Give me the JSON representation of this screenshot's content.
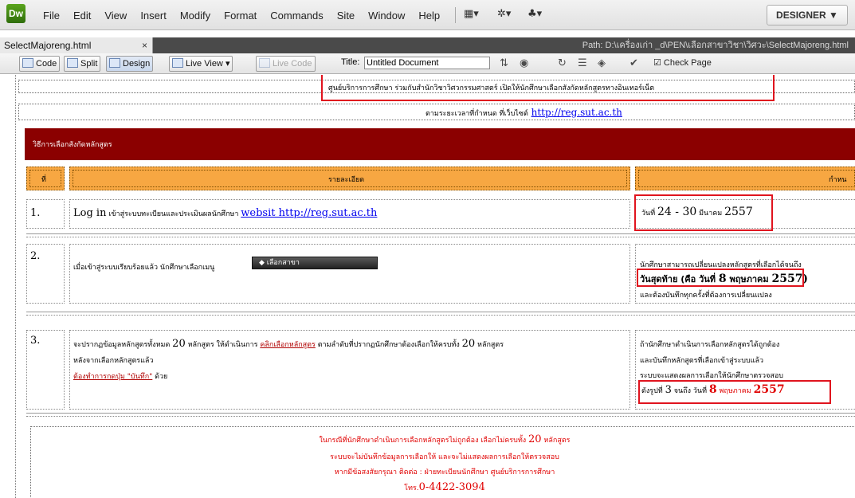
{
  "app": {
    "logo": "Dw",
    "menu": [
      "File",
      "Edit",
      "View",
      "Insert",
      "Modify",
      "Format",
      "Commands",
      "Site",
      "Window",
      "Help"
    ],
    "workspace": "DESIGNER ▼"
  },
  "document": {
    "tab_name": "SelectMajoreng.html",
    "close": "×",
    "path": "Path:  D:\\เครื่องเก่า _d\\PEN\\เลือกสาขาวิชา\\วิศวะ\\SelectMajoreng.html"
  },
  "toolbar": {
    "code": "Code",
    "split": "Split",
    "design": "Design",
    "live_view": "Live View",
    "live_code": "Live Code",
    "title_label": "Title:",
    "title_value": "Untitled Document",
    "check_page": "Check Page"
  },
  "page": {
    "intro_line": "ศูนย์บริการการศึกษา ร่วมกับสำนักวิชาวิศวกรรมศาสตร์ เปิดให้นักศึกษาเลือกสังกัดหลักสูตรทางอินเทอร์เน็ต",
    "schedule_prefix": "ตามระยะเวลาที่กำหนด ที่เว็บไซต์",
    "schedule_link": "http://reg.sut.ac.th",
    "banner": "วิธีการเลือกสังกัดหลักสูตร",
    "headers": {
      "no": "ที่",
      "detail": "รายละเอียด",
      "deadline": "กำหน"
    },
    "row1": {
      "no": "1.",
      "text_login": "Log in",
      "text": " เข้าสู่ระบบทะเบียนและประเมินผลนักศึกษา ",
      "link": "websit http://reg.sut.ac.th",
      "date_prefix": "วันที่ ",
      "date_num": "24 - 30",
      "date_month": " มีนาคม ",
      "date_year": "2557"
    },
    "row2": {
      "no": "2.",
      "text": "เมื่อเข้าสู่ระบบเรียบร้อยแล้ว นักศึกษาเลือกเมนู",
      "menu_button": "◆  เลือกสาขา",
      "right_line1": "นักศึกษาสามารถเปลี่ยนแปลงหลักสูตรที่เลือกได้จนถึง",
      "right_line2_a": "วันสุดท้าย (คือ วันที่ ",
      "right_line2_b": "8",
      "right_line2_c": " พฤษภาคม ",
      "right_line2_d": "2557)",
      "right_line3": "และต้องบันทึกทุกครั้งที่ต้องการเปลี่ยนแปลง"
    },
    "row3": {
      "no": "3.",
      "line1_a": "จะปรากฏข้อมูลหลักสูตรทั้งหมด ",
      "line1_num": "20",
      "line1_b": " หลักสูตร ให้ดำเนินการ ",
      "line1_link": "คลิกเลือกหลักสูตร",
      "line1_c": " ตามลำดับที่ปรากฏนักศึกษาต้องเลือกให้ครบทั้ง ",
      "line1_num2": "20",
      "line1_d": " หลักสูตร",
      "line2": "หลังจากเลือกหลักสูตรแล้ว",
      "line3_a": "ต้องทำการกดปุ่ม \"บันทึก\"",
      "line3_b": " ด้วย",
      "right_line1": "ถ้านักศึกษาดำเนินการเลือกหลักสูตรได้ถูกต้อง",
      "right_line2": "และบันทึกหลักสูตรที่เลือกเข้าสู่ระบบแล้ว",
      "right_line3": "ระบบจะแสดงผลการเลือกให้นักศึกษาตรวจสอบ",
      "right_line4_a": "ดังรูปที่ ",
      "right_line4_b": "3",
      "right_line4_c": " จนถึง วันที่ ",
      "right_line4_d": "8",
      "right_line4_e": " พฤษภาคม ",
      "right_line4_f": "2557"
    },
    "notice": {
      "line1_a": "ในกรณีที่นักศึกษาดำเนินการเลือกหลักสูตรไม่ถูกต้อง  เลือกไม่ครบทั้ง ",
      "line1_num": "20",
      "line1_b": " หลักสูตร",
      "line2": "ระบบจะไม่บันทึกข้อมูลการเลือกให้ และจะไม่แสดงผลการเลือกให้ตรวจสอบ",
      "line3": "หากมีข้อสงสัยกรุณา ติดต่อ : ฝ่ายทะเบียนนักศึกษา ศูนย์บริการการศึกษา",
      "line4_a": "โทร.",
      "line4_b": "0-4422-3094"
    }
  },
  "colors": {
    "banner": "#8b0000",
    "header": "#f7a742",
    "highlight_box": "#e0141e",
    "notice_text": "#e00000"
  }
}
